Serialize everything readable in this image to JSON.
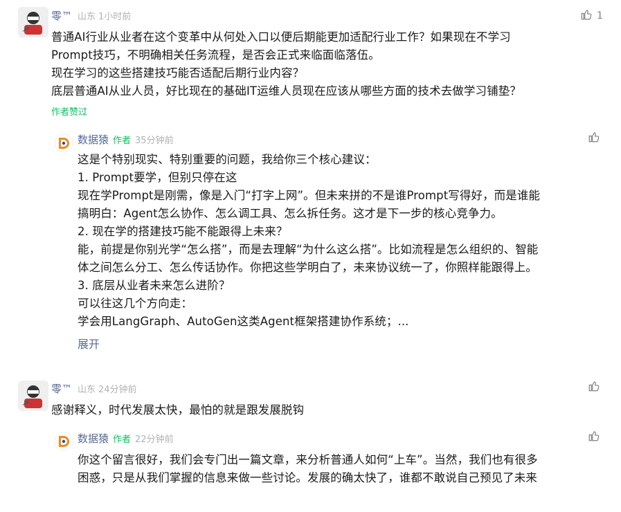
{
  "comments": [
    {
      "user": "零™",
      "location": "山东",
      "time": "1小时前",
      "likes": "1",
      "lines": [
        "普通AI行业从业者在这个变革中从何处入口以便后期能更加适配行业工作？如果现在不学习",
        "Prompt技巧，不明确相关任务流程，是否会正式来临面临落伍。",
        "现在学习的这些搭建技巧能否适配后期行业内容？",
        "底层普通AI从业人员，好比现在的基础IT运维人员现在应该从哪些方面的技术去做学习铺垫？"
      ],
      "badge": "作者赞过",
      "reply": {
        "user": "数据猿",
        "tag": "作者",
        "time": "35分钟前",
        "lines": [
          "这是个特别现实、特别重要的问题，我给你三个核心建议：",
          "1. Prompt要学，但别只停在这",
          "现在学Prompt是刚需，像是入门“打字上网”。但未来拼的不是谁Prompt写得好，而是谁能",
          "搞明白：Agent怎么协作、怎么调工具、怎么拆任务。这才是下一步的核心竞争力。",
          "2. 现在学的搭建技巧能不能跟得上未来？",
          "能，前提是你别光学“怎么搭”，而是去理解“为什么这么搭”。比如流程是怎么组织的、智能",
          "体之间怎么分工、怎么传话协作。你把这些学明白了，未来协议统一了，你照样能跟得上。",
          "3. 底层从业者未来怎么进阶？",
          "可以往这几个方向走：",
          "学会用LangGraph、AutoGen这类Agent框架搭建协作系统；..."
        ],
        "expand": "展开"
      }
    },
    {
      "user": "零™",
      "location": "山东",
      "time": "24分钟前",
      "lines": [
        "感谢释义，时代发展太快，最怕的就是跟发展脱钩"
      ],
      "reply": {
        "user": "数据猿",
        "tag": "作者",
        "time": "22分钟前",
        "lines": [
          "你这个留言很好，我们会专门出一篇文章，来分析普通人如何“上车”。当然，我们也有很多",
          "困惑，只是从我们掌握的信息来做一些讨论。发展的确太快了，谁都不敢说自己预见了未来"
        ]
      }
    }
  ],
  "colors": {
    "name": "#576b95",
    "meta": "#b2b2b2",
    "author_tag": "#07c160",
    "text": "#1a1a1a",
    "icon": "#7f7f7f"
  },
  "icons": [
    "avatar-icon",
    "thumbs-up-icon",
    "author-logo-icon"
  ]
}
